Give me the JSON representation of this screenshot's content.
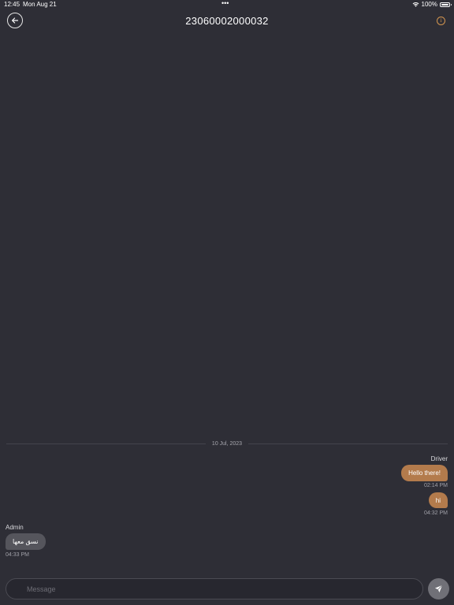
{
  "status_bar": {
    "time": "12:45",
    "date": "Mon Aug 21",
    "dots": "•••",
    "battery": "100%"
  },
  "header": {
    "title": "23060002000032",
    "back_icon": "arrow-left-icon",
    "info_icon": "info-icon",
    "info_glyph": "i"
  },
  "chat": {
    "date_separator": "10 Jul, 2023",
    "messages": [
      {
        "sender": "Driver",
        "text": "Hello there!",
        "time": "02:14 PM",
        "direction": "outgoing"
      },
      {
        "sender": "",
        "text": "hi",
        "time": "04:32 PM",
        "direction": "outgoing"
      },
      {
        "sender": "Admin",
        "text": "نسق معها",
        "time": "04:33 PM",
        "direction": "incoming"
      }
    ]
  },
  "composer": {
    "value": "",
    "placeholder": "Message",
    "send_icon": "send-icon"
  },
  "colors": {
    "background": "#2e2e36",
    "accent": "#d3954f",
    "outgoing_bubble": "#b37b4c",
    "incoming_bubble": "#55555c"
  }
}
